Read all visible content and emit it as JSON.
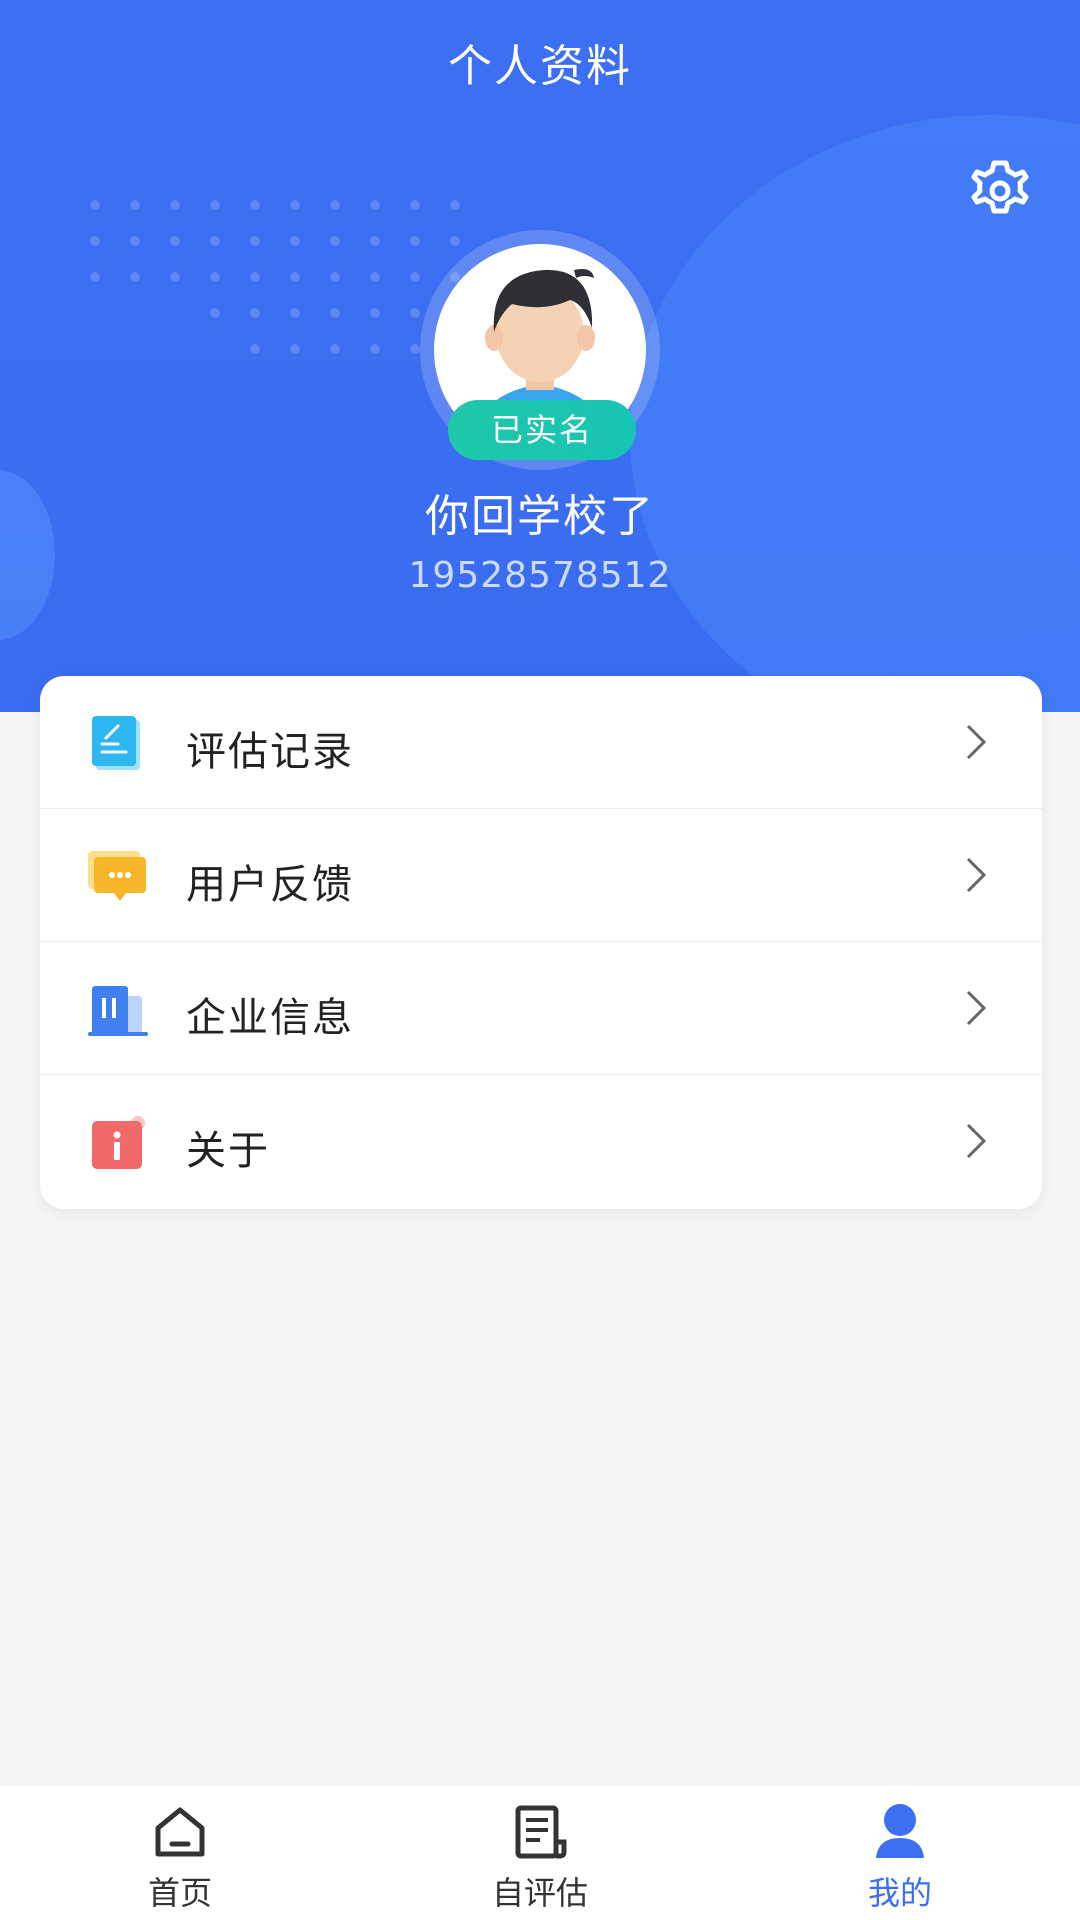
{
  "header": {
    "title": "个人资料",
    "settings_icon": "gear-icon"
  },
  "profile": {
    "avatar_icon": "avatar-icon",
    "verified_badge": "已实名",
    "name": "你回学校了",
    "phone": "19528578512"
  },
  "menu": [
    {
      "label": "评估记录",
      "icon": "document-icon"
    },
    {
      "label": "用户反馈",
      "icon": "chat-bubble-icon"
    },
    {
      "label": "企业信息",
      "icon": "building-icon"
    },
    {
      "label": "关于",
      "icon": "info-icon"
    }
  ],
  "tabbar": {
    "items": [
      {
        "label": "首页",
        "icon": "home-icon"
      },
      {
        "label": "自评估",
        "icon": "form-icon"
      },
      {
        "label": "我的",
        "icon": "person-icon"
      }
    ],
    "active_index": 2
  },
  "colors": {
    "primary": "#3d6ff2",
    "badge": "#1fc8a9",
    "background": "#f5f5f7"
  }
}
